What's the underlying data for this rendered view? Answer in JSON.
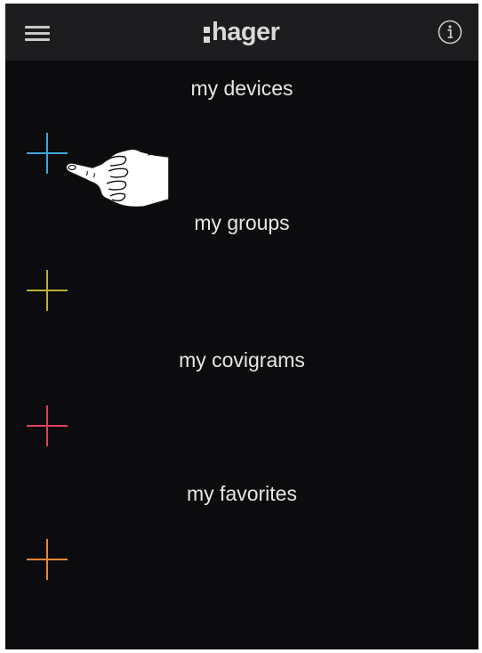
{
  "header": {
    "logo_text": "hager",
    "menu_icon": "hamburger-menu-icon",
    "info_icon": "info-icon",
    "background": "#1d1d1f",
    "icon_color": "#c9c9c9"
  },
  "sections": [
    {
      "title": "my devices",
      "add_icon": "plus-icon",
      "color": "#3ea6d8"
    },
    {
      "title": "my groups",
      "add_icon": "plus-icon",
      "color": "#b9b03a"
    },
    {
      "title": "my covigrams",
      "add_icon": "plus-icon",
      "color": "#e0405a"
    },
    {
      "title": "my favorites",
      "add_icon": "plus-icon",
      "color": "#e8853a"
    }
  ],
  "overlay": {
    "pointer_icon": "pointing-hand-icon"
  },
  "colors": {
    "screen_background": "#0c0c0e",
    "text": "#e6e6e6"
  }
}
